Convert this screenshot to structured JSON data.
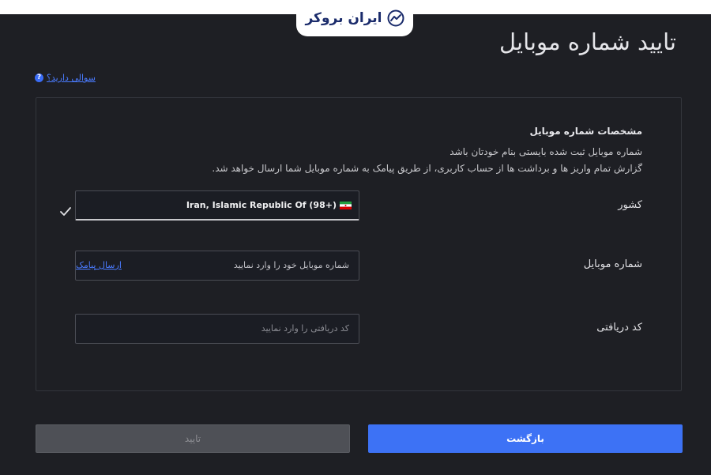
{
  "header": {
    "logo_text": "ایران بروکر",
    "page_title": "تایید شماره موبایل",
    "help_text": "سوالی دارید؟",
    "help_icon_glyph": "?"
  },
  "section": {
    "title": "مشخصات شماره موبایل",
    "description_1": "شماره موبایل ثبت شده بایستی بنام خودتان باشد",
    "description_2": "گزارش تمام واریز ها و برداشت ها از حساب کاربری، از طریق پیامک به شماره موبایل شما ارسال خواهد شد."
  },
  "form": {
    "country_label": "کشور",
    "country_value": "Iran, Islamic Republic Of (98+)",
    "mobile_label": "شماره موبایل",
    "mobile_placeholder": "شماره موبایل خود را وارد نمایید",
    "send_sms_label": "ارسال پیامک",
    "code_label": "کد دریافتی",
    "code_placeholder": "کد دریافتی را وارد نمایید"
  },
  "buttons": {
    "back_label": "بازگشت",
    "confirm_label": "تایید"
  },
  "colors": {
    "background": "#1e1f24",
    "accent": "#3d72f5",
    "link": "#4a7bff",
    "disabled": "#4e5056"
  }
}
